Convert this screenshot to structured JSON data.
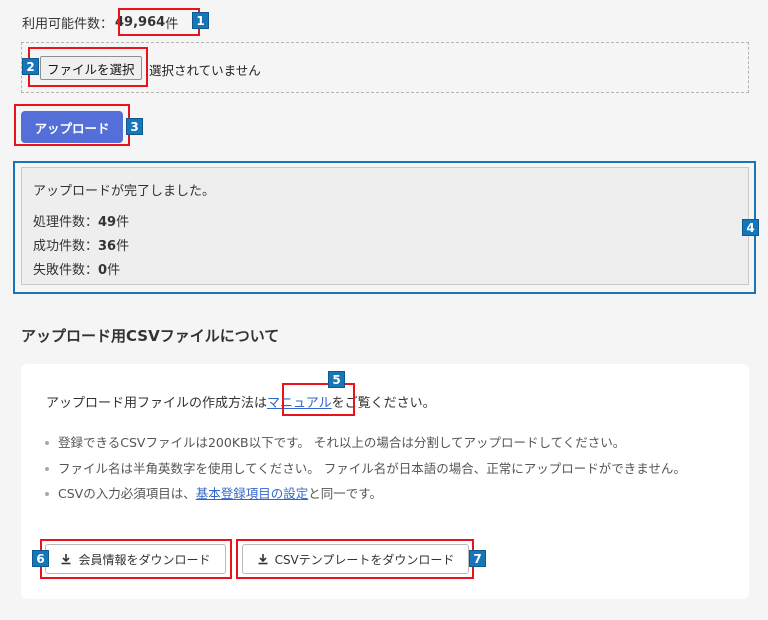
{
  "available": {
    "label": "利用可能件数：",
    "value": "49,964",
    "unit": "件"
  },
  "file_input": {
    "button_label": "ファイルを選択",
    "status": "選択されていません"
  },
  "upload": {
    "button_label": "アップロード"
  },
  "result": {
    "title": "アップロードが完了しました。",
    "processed_label": "処理件数：",
    "processed_value": "49",
    "processed_unit": "件",
    "success_label": "成功件数：",
    "success_value": "36",
    "success_unit": "件",
    "failed_label": "失敗件数：",
    "failed_value": "0",
    "failed_unit": "件"
  },
  "section": {
    "heading": "アップロード用CSVファイルについて"
  },
  "info": {
    "intro_prefix": "アップロード用ファイルの作成方法は",
    "manual_link": "マニュアル",
    "intro_suffix": "をご覧ください。",
    "notes": [
      "登録できるCSVファイルは200KB以下です。 それ以上の場合は分割してアップロードしてください。",
      "ファイル名は半角英数字を使用してください。 ファイル名が日本語の場合、正常にアップロードができません。"
    ],
    "note3_prefix": "CSVの入力必須項目は、",
    "note3_link": "基本登録項目の設定",
    "note3_suffix": "と同一です。"
  },
  "downloads": {
    "member_label": "会員情報をダウンロード",
    "template_label": "CSVテンプレートをダウンロード",
    "icon": "download-icon"
  },
  "badges": {
    "b1": "1",
    "b2": "2",
    "b3": "3",
    "b4": "4",
    "b5": "5",
    "b6": "6",
    "b7": "7"
  },
  "colors": {
    "accent": "#5470d8",
    "annotation_red": "#e8141c",
    "annotation_blue": "#1676b8",
    "link": "#3366cc"
  }
}
